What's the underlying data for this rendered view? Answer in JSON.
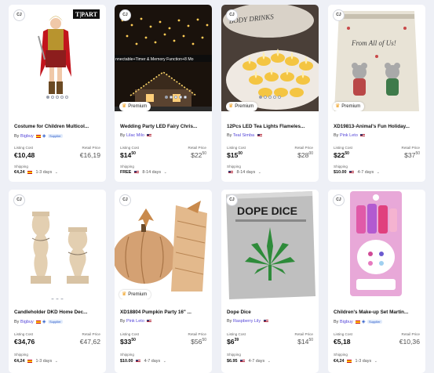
{
  "source_logo_text": "CJ",
  "premium_label": "Premium",
  "listing_cost_label": "Listing Cost",
  "retail_price_label": "Retail Price",
  "shipping_label": "Shipping",
  "by_label": "By",
  "supplier_badge": "Supplier",
  "colors": {
    "seller": "#5546d8",
    "premium_crown": "#f0a020",
    "card_bg": "#ffffff",
    "page_bg": "#eef0f6"
  },
  "products": [
    {
      "title": "Costume for Children Multicol...",
      "seller": "Bigbuy",
      "flag": "es",
      "supplier": true,
      "listing_cost": "€10,48",
      "retail_price": "€16,19",
      "shipping_cost": "€4,24",
      "shipping_days": "1-3 days",
      "premium": false,
      "image_dots": 5,
      "image_overlay": ""
    },
    {
      "title": "Wedding Party LED Fairy Chris...",
      "seller": "Lilac Milo",
      "flag": "us",
      "supplier": false,
      "listing_cost": "$14",
      "listing_cost_cents": "50",
      "retail_price": "$22",
      "retail_price_cents": "50",
      "shipping_cost": "FREE",
      "shipping_days": "8-14 days",
      "premium": true,
      "image_dots": 5,
      "image_overlay": "nnectable+Timer & Memory Function+8 Mo"
    },
    {
      "title": "12Pcs LED Tea Lights Flameles...",
      "seller": "Teal Simba",
      "flag": "us",
      "supplier": false,
      "listing_cost": "$15",
      "listing_cost_cents": "00",
      "retail_price": "$28",
      "retail_price_cents": "00",
      "shipping_cost": "",
      "shipping_days": "8-14 days",
      "premium": true,
      "image_dots": 5,
      "image_overlay": ""
    },
    {
      "title": "XD19813-Animal's Fun Holiday...",
      "seller": "Pink Leto",
      "flag": "us",
      "supplier": false,
      "listing_cost": "$22",
      "listing_cost_cents": "50",
      "retail_price": "$37",
      "retail_price_cents": "50",
      "shipping_cost": "$10.00",
      "shipping_days": "4-7 days",
      "premium": true,
      "image_dots": 0,
      "image_overlay": "From All of Us!"
    },
    {
      "title": "Candleholder DKD Home Dec...",
      "seller": "Bigbuy",
      "flag": "es",
      "supplier": true,
      "listing_cost": "€34,76",
      "retail_price": "€47,62",
      "shipping_cost": "€4,24",
      "shipping_days": "1-3 days",
      "premium": false,
      "image_dots": 3,
      "image_overlay": ""
    },
    {
      "title": "XD18804 Pumpkin Party 16\" ...",
      "seller": "Pink Leto",
      "flag": "us",
      "supplier": false,
      "listing_cost": "$33",
      "listing_cost_cents": "50",
      "retail_price": "$56",
      "retail_price_cents": "50",
      "shipping_cost": "$10.00",
      "shipping_days": "4-7 days",
      "premium": true,
      "image_dots": 0,
      "image_overlay": ""
    },
    {
      "title": "Dope Dice",
      "seller": "Raspberry Lily",
      "flag": "us",
      "supplier": false,
      "listing_cost": "$6",
      "listing_cost_cents": "39",
      "retail_price": "$14",
      "retail_price_cents": "50",
      "shipping_cost": "$6.95",
      "shipping_days": "4-7 days",
      "premium": false,
      "image_dots": 0,
      "image_overlay": "DOPE DICE"
    },
    {
      "title": "Children's Make-up Set Martin...",
      "seller": "Bigbuy",
      "flag": "es",
      "supplier": true,
      "listing_cost": "€5,18",
      "retail_price": "€10,36",
      "shipping_cost": "€4,24",
      "shipping_days": "1-3 days",
      "premium": false,
      "image_dots": 3,
      "image_overlay": ""
    }
  ]
}
